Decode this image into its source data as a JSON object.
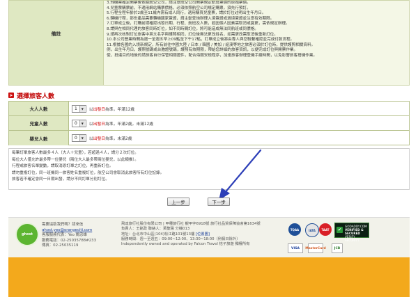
{
  "notes": {
    "label": "備註",
    "lines": [
      "3.飛機票確定開票後依據航空公司，請注意航空公司開票規定航班票價的原始票價。",
      "4.兒童票購票前，不適用網站購票價格，必須依照航空公司規定購票，須先行預訂。",
      "5.行程全程年齡於2歲至11歲內需有成人同行，適用購買兒童票，請於訂位註明出生年月日。",
      "6.轉機行程，部份產品需要轉機國家簽證，請主動查詢辦理入境簽證或過境簽證並注意有效期限。",
      "7.訂單成立後，訂購前請確認出發日期、行程、航班及人數，若因個人因素需取消或變更，需依規定辦理。",
      "8.請與在相同代理的旅客同時訂位，如不同時間訂位，將可能造成無法同航班或同價格。",
      "9.請再次核對訂位旅客中英文名字與護照相同，訂位後無法更改姓名，如需更改需取消後重新訂位。",
      "10.本公司營業時間為週一至週五早上09點至下午17點，訂單成立後將由專人與您聯繫確認並完成付款流程。",
      "11.根據各國的入境新規定，所有前往中國大陸 / 日本 / 韓國 / 美加 / 紐澳等地之旅客必須於訂位時，提供護照相關資料。",
      "   例，出生年月日，護照號碼或台胞證號碼，護照有效期限，帶給您詳細的旅客資訊，以便完成訂位與開票作業。",
      "   使，抵達目的地後的請旅客自行保管相關證件，配合海關安檢程序，加速旅客辦理登機手續時間，以免影響旅客搭機作業。"
    ]
  },
  "section": {
    "icon": "➤",
    "title": "選擇旅客人數"
  },
  "travelers": [
    {
      "label": "大人人數",
      "value": "1",
      "note_prefix": "以",
      "note_red": "出發日",
      "note_suffix": "為準，年滿12歲"
    },
    {
      "label": "兒童人數",
      "value": "0",
      "note_prefix": "以",
      "note_red": "出發日",
      "note_suffix": "為準，年滿2歲，未滿12歲"
    },
    {
      "label": "嬰兒人數",
      "value": "0",
      "note_prefix": "以",
      "note_red": "出發日",
      "note_suffix": "為準，未滿2歲"
    }
  ],
  "rules": [
    "每筆訂單旅客人數最多４人（大人＋兒童），若超過４人，請分２次訂位。",
    "每位大人僅允許最多帶一位嬰兒（兩位大人最多帶兩位嬰兒，以此類推）。",
    "行程或旅客名單變動，請取消原訂單之訂位，再重新訂位。",
    "請勿重複訂位，同一班機同一旅客姓名重複訂位，航空公司會取消此旅客所有訂位記錄。",
    "旅客若不確定會同一日期出發，請分不同訂單分別訂位。"
  ],
  "buttons": {
    "prev": "上一步",
    "next": "下一步"
  },
  "footer": {
    "ghost_label": "ghost",
    "contact": {
      "line1": "需要協助我們嗎？請來信",
      "email": "ghost.yeo@orangeciti.com",
      "line3": "客服服務代表：Yeo 姚忠雄",
      "phone": "服務電話：02-25035788#233",
      "fax": "傳真：02-25035119"
    },
    "company": {
      "line1": "飛達旅行社股份有限公司 | 甲種旅行社  觀甲字6918號  旅行社品質保障協會第1634號",
      "line2": "負責人：王銘政    聯絡人：黃聖陽  分機013",
      "line3_prefix": "地址：台北市中山區(104)松江路101號13樓 ",
      "line3_link": "[位置圖]",
      "line4": "服務時間：週一至週五：09:00~12:00、13:30~18:00（例假日除外）",
      "line5": "Independently owned and operated by Falcon Travel 桔子旅遊 獨權所有"
    },
    "badges": [
      "TQAA",
      "IATA",
      "TAAT"
    ],
    "verified": {
      "line1": "GODADDY.COM",
      "line2": "VERIFIED & SECURED",
      "line3": "VERIFY SECURITY"
    },
    "cards": [
      "VISA",
      "MasterCard",
      "JCB"
    ]
  }
}
